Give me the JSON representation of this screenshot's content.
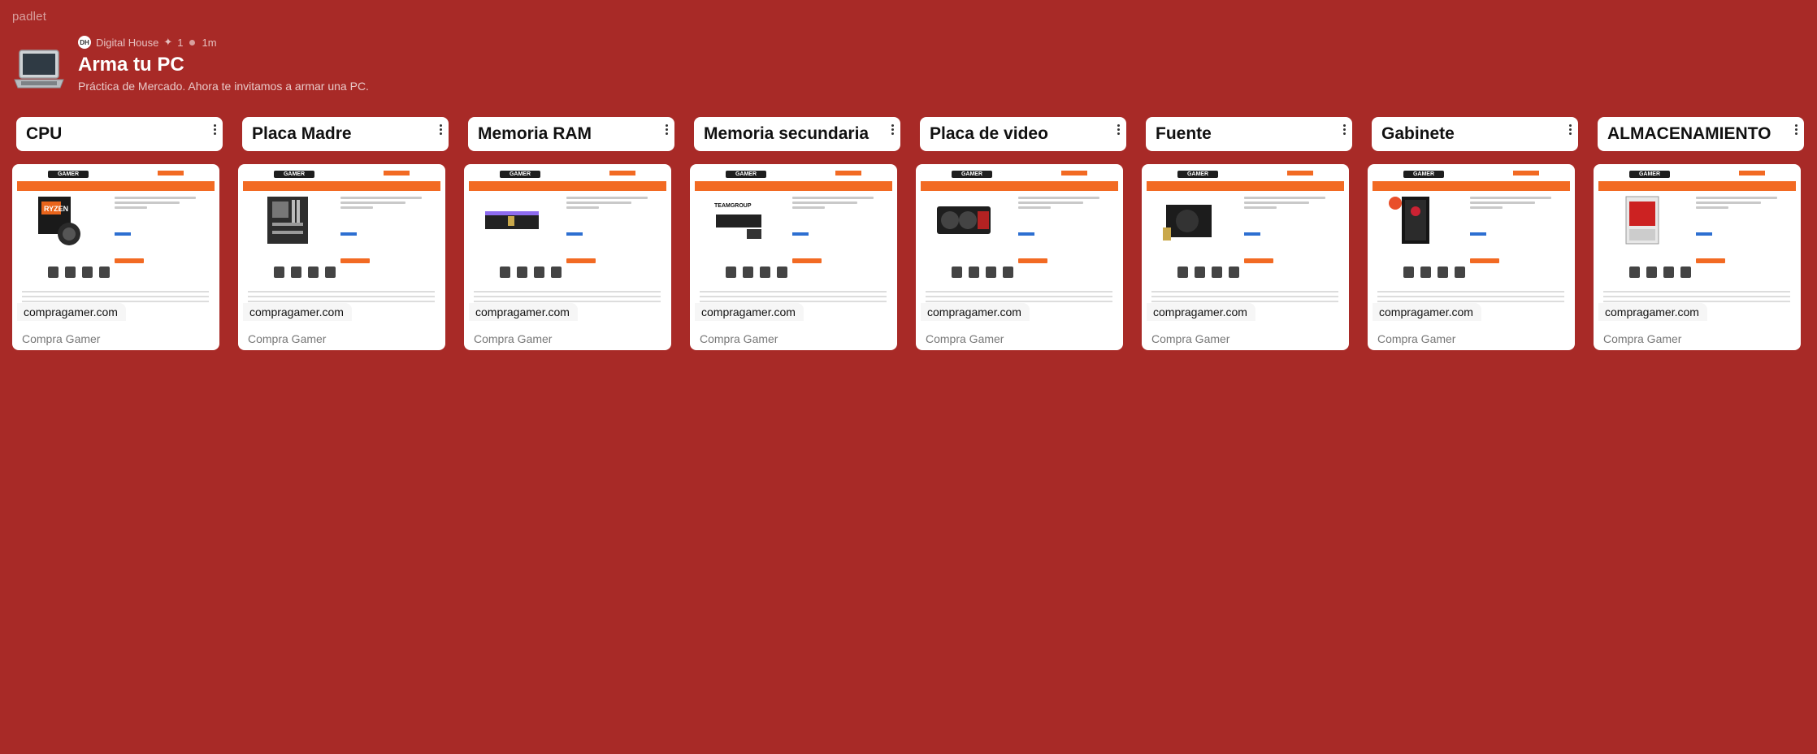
{
  "app": {
    "brand": "padlet"
  },
  "header": {
    "author": "Digital House",
    "author_initials": "DH",
    "likes": "1",
    "time": "1m",
    "title": "Arma tu PC",
    "description": "Práctica de Mercado. Ahora te invitamos a armar una PC.",
    "icon": "laptop-icon"
  },
  "colors": {
    "background": "#A82A27",
    "accent": "#F26A23",
    "card": "#FFFFFF"
  },
  "columns": [
    {
      "title": "CPU",
      "card": {
        "domain": "compragamer.com",
        "title": "Compra Gamer",
        "image": "ryzen-cpu-box"
      }
    },
    {
      "title": "Placa Madre",
      "card": {
        "domain": "compragamer.com",
        "title": "Compra Gamer",
        "image": "motherboard"
      }
    },
    {
      "title": "Memoria RAM",
      "card": {
        "domain": "compragamer.com",
        "title": "Compra Gamer",
        "image": "ram-stick"
      }
    },
    {
      "title": "Memoria secundaria",
      "card": {
        "domain": "compragamer.com",
        "title": "Compra Gamer",
        "image": "nvme-ssd"
      }
    },
    {
      "title": "Placa de video",
      "card": {
        "domain": "compragamer.com",
        "title": "Compra Gamer",
        "image": "graphics-card"
      }
    },
    {
      "title": "Fuente",
      "card": {
        "domain": "compragamer.com",
        "title": "Compra Gamer",
        "image": "power-supply"
      }
    },
    {
      "title": "Gabinete",
      "card": {
        "domain": "compragamer.com",
        "title": "Compra Gamer",
        "image": "pc-case"
      }
    },
    {
      "title": "ALMACENAMIENTO",
      "card": {
        "domain": "compragamer.com",
        "title": "Compra Gamer",
        "image": "hard-drive"
      }
    }
  ]
}
